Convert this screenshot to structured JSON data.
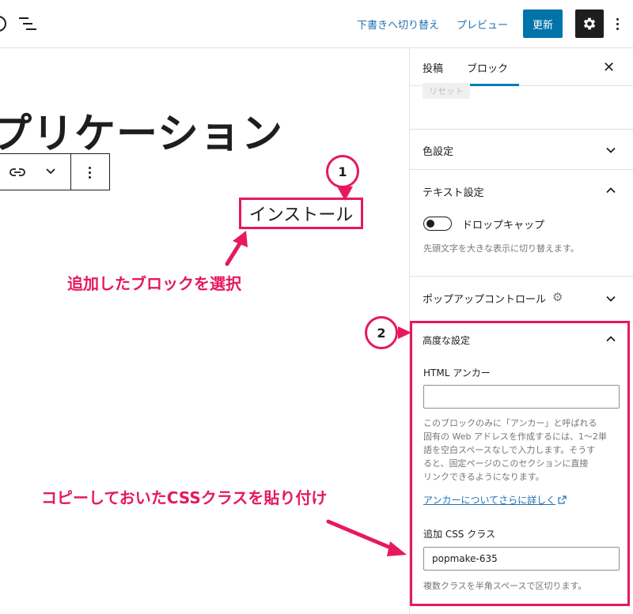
{
  "topbar": {
    "switch_draft": "下書きへ切り替え",
    "preview": "プレビュー",
    "update": "更新",
    "settings_icon": "gear-icon",
    "more_icon": "more-vertical-icon"
  },
  "editor": {
    "title": "プリケーション",
    "selected_block_text": "インストール"
  },
  "sidebar": {
    "tabs": [
      {
        "label": "投稿"
      },
      {
        "label": "ブロック"
      }
    ],
    "reset_label": "リセット",
    "panels": {
      "color": {
        "title": "色設定"
      },
      "text": {
        "title": "テキスト設定",
        "dropcap_label": "ドロップキャップ",
        "dropcap_help": "先頭文字を大きな表示に切り替えます。",
        "dropcap_enabled": false
      },
      "popup": {
        "title": "ポップアップコントロール"
      },
      "advanced": {
        "title": "高度な設定",
        "html_anchor_label": "HTML アンカー",
        "html_anchor_value": "",
        "help_lines": [
          "このブロックのみに「アンカー」と呼ばれる",
          "固有の Web アドレスを作成するには、1〜2単",
          "語を空白スペースなしで入力します。そうす",
          "ると、固定ページのこのセクションに直接",
          "リンクできるようになります。"
        ],
        "anchor_link": "アンカーについてさらに詳しく",
        "css_label": "追加 CSS クラス",
        "css_value": "popmake-635",
        "css_help": "複数クラスを半角スペースで区切ります。"
      }
    }
  },
  "annotations": {
    "badge_1": "1",
    "badge_2": "2",
    "note_1": "追加したブロックを選択",
    "note_2": "コピーしておいたCSSクラスを貼り付け",
    "color": "#e6195e"
  },
  "colors": {
    "accent": "#0073aa",
    "link": "#2271b1",
    "annotation": "#e6195e"
  }
}
